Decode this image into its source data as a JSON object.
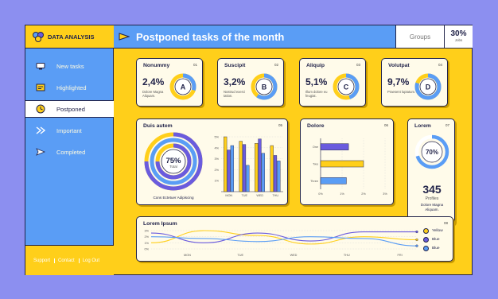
{
  "brand": {
    "label": "DATA ANALYSIS",
    "icon": "molecule-logo-icon"
  },
  "header": {
    "title": "Postponed tasks of the month",
    "groups_label": "Groups",
    "jobs_value": "30%",
    "jobs_label": "Jobs"
  },
  "sidebar": {
    "items": [
      {
        "label": "New tasks",
        "icon": "monitor-icon"
      },
      {
        "label": "Highlighted",
        "icon": "highlight-icon"
      },
      {
        "label": "Postponed",
        "icon": "clock-icon",
        "active": true
      },
      {
        "label": "Important",
        "icon": "chevrons-icon"
      },
      {
        "label": "Completed",
        "icon": "send-icon"
      }
    ],
    "footer": [
      "Support",
      "Contact",
      "Log Out"
    ]
  },
  "kpis": [
    {
      "title": "Nonummy",
      "num": "01",
      "value": "2,4%",
      "letter": "A",
      "desc": "Dolore Magna Aliquam.",
      "fill": 0.3
    },
    {
      "title": "Suscipit",
      "num": "02",
      "value": "3,2%",
      "letter": "B",
      "desc": "Nostrud exerci tation.",
      "fill": 0.6
    },
    {
      "title": "Aliquip",
      "num": "03",
      "value": "5,1%",
      "letter": "C",
      "desc": "Illum dolore eu feugiat.",
      "fill": 0.45
    },
    {
      "title": "Volutpat",
      "num": "04",
      "value": "9,7%",
      "letter": "D",
      "desc": "Praesent luptatum.",
      "fill": 0.8
    }
  ],
  "duis": {
    "title": "Duis autem",
    "num": "05",
    "value": "75%",
    "label": "Total",
    "caption": "Cons Ectetuer Adipiscing"
  },
  "dolore": {
    "title": "Dolore",
    "num": "06"
  },
  "lorem": {
    "title": "Lorem",
    "num": "07",
    "value": "70%",
    "count": "345",
    "count_label": "Profiles",
    "desc": "Dolore Magna Aliquam."
  },
  "ipsum": {
    "title": "Lorem Ipsum",
    "num": "08",
    "legend": [
      "Yellow",
      "Blue",
      "Blue"
    ]
  },
  "colors": {
    "yellow": "#ffcf1a",
    "blue": "#5a9df5",
    "purple": "#6a5bde",
    "navy": "#22244a"
  },
  "chart_data": [
    {
      "type": "bar",
      "categories": [
        "MON",
        "TUE",
        "WED",
        "THU"
      ],
      "yticks": [
        "5%",
        "4%",
        "3%",
        "2%",
        "1%"
      ],
      "ylim": [
        0,
        5
      ],
      "series": [
        {
          "values": [
            5.0,
            4.6,
            4.4,
            4.2
          ]
        },
        {
          "values": [
            3.8,
            4.3,
            4.8,
            3.3
          ]
        },
        {
          "values": [
            4.2,
            2.4,
            3.5,
            2.8
          ]
        }
      ]
    },
    {
      "type": "bar",
      "orientation": "horizontal",
      "categories": [
        "One",
        "Two",
        "Three"
      ],
      "xticks": [
        "0%",
        "1%",
        "2%",
        "3%"
      ],
      "xlim": [
        0,
        3
      ],
      "values": [
        1.3,
        2.0,
        1.2
      ]
    },
    {
      "type": "line",
      "categories": [
        "MON",
        "TUE",
        "WED",
        "THU",
        "FRI"
      ],
      "yticks": [
        "3%",
        "2%",
        "1%",
        "0%"
      ],
      "ylim": [
        0,
        3
      ],
      "series": [
        {
          "name": "Yellow",
          "values": [
            1.0,
            3.0,
            2.2,
            0.8,
            2.0,
            1.5
          ]
        },
        {
          "name": "Blue",
          "values": [
            2.6,
            1.0,
            2.6,
            1.3,
            2.8,
            2.8
          ]
        },
        {
          "name": "Blue",
          "values": [
            2.0,
            1.7,
            1.2,
            2.0,
            1.7,
            0.5
          ]
        }
      ]
    }
  ]
}
